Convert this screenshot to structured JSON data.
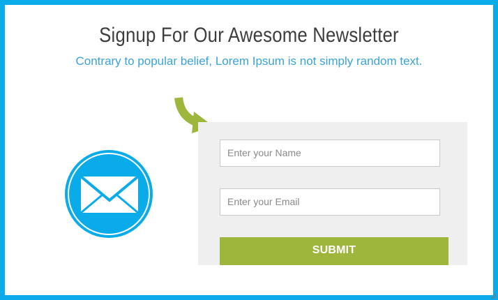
{
  "header": {
    "title": "Signup For Our Awesome Newsletter",
    "subtitle": "Contrary to popular belief, Lorem Ipsum is not simply random text."
  },
  "form": {
    "name_placeholder": "Enter your Name",
    "email_placeholder": "Enter your Email",
    "submit_label": "SUBMIT"
  },
  "icons": {
    "mail": "envelope-icon",
    "arrow": "curved-arrow-icon",
    "resize": "resize-grip-icon"
  },
  "colors": {
    "border": "#0aabe9",
    "accent_blue": "#3aa3d9",
    "button_green": "#9eb63b",
    "panel_gray": "#efefef"
  }
}
